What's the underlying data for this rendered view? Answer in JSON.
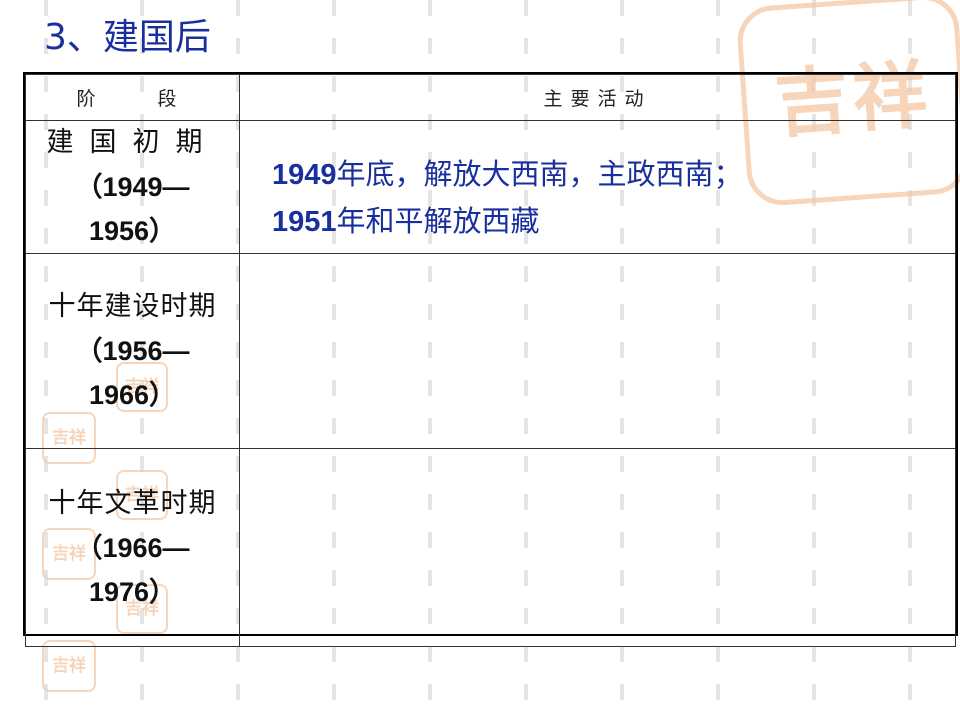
{
  "heading": "3、建国后",
  "table": {
    "headers": {
      "stage": "阶段",
      "activity": "主要活动"
    },
    "rows": [
      {
        "stage_name": "建国初期",
        "years_open": "（1949—",
        "years_close": "1956）",
        "activities": [
          {
            "year": "1949",
            "text": "年底，解放大西南，主政西南；"
          },
          {
            "year": "1951",
            "text": "年和平解放西藏"
          }
        ]
      },
      {
        "stage_name": "十年建设时期",
        "years_open": "（1956—",
        "years_close": "1966）",
        "activities": []
      },
      {
        "stage_name": "十年文革时期",
        "years_open": "（1966—",
        "years_close": "1976）",
        "activities": []
      }
    ]
  },
  "decorations": {
    "stamp_text": "吉祥",
    "stamp_color": "#f4c7a4",
    "heading_color": "#1a2f9e",
    "activity_color": "#1a2f9e"
  }
}
